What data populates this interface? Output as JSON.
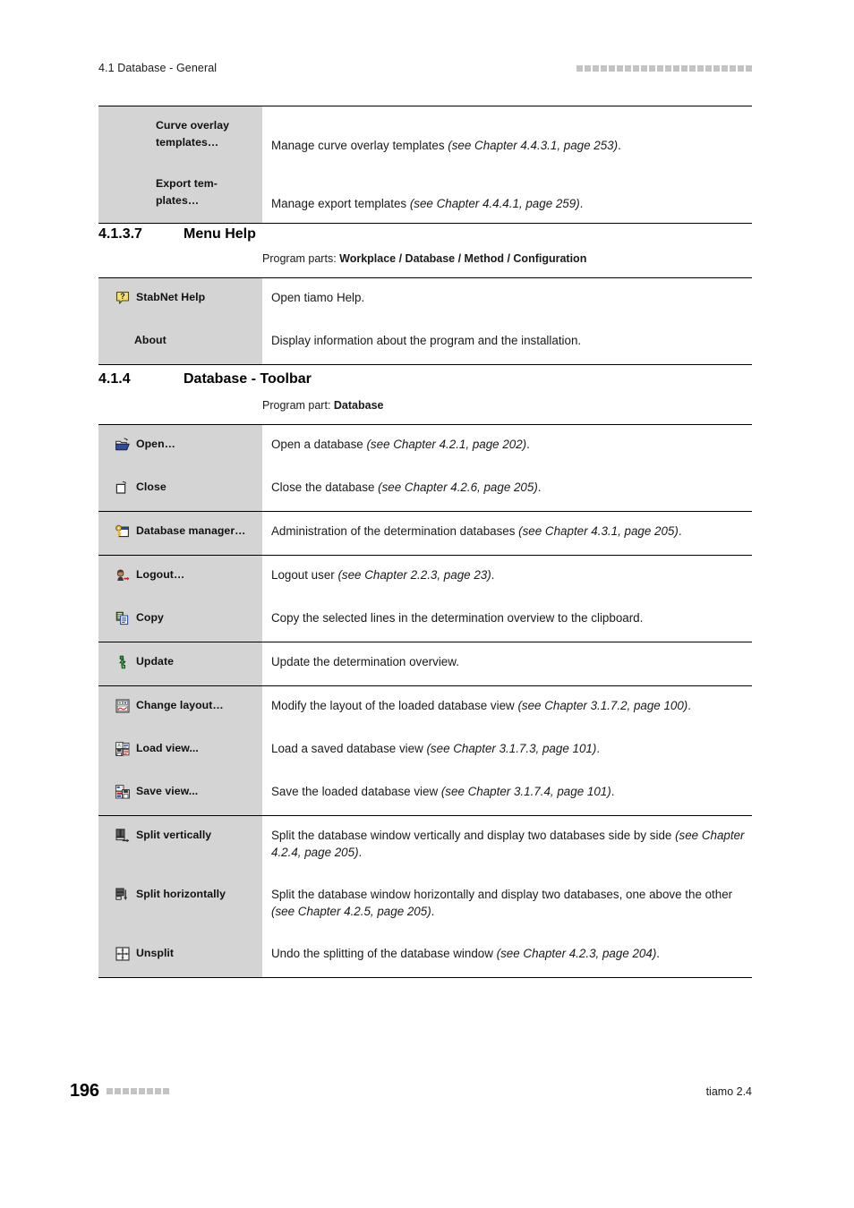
{
  "header": {
    "running_title": "4.1 Database - General",
    "decor_squares": 22
  },
  "footer": {
    "page_number": "196",
    "decor_squares": 8,
    "product": "tiamo 2.4"
  },
  "colors": {
    "label_column_bg": "#d4d4d4",
    "decor_square": "#c3c3c3",
    "rule": "#000000"
  },
  "top_table": {
    "groups": [
      {
        "rows": [
          {
            "icon": "",
            "label": "Curve overlay templates…",
            "desc_plain": "Manage curve overlay templates ",
            "desc_italic": "(see Chapter 4.4.3.1, page 253)",
            "desc_tail": "."
          },
          {
            "icon": "",
            "label": "Export tem-plates…",
            "desc_plain": "Manage export templates ",
            "desc_italic": "(see Chapter 4.4.4.1, page 259)",
            "desc_tail": "."
          }
        ]
      }
    ]
  },
  "section_help": {
    "number": "4.1.3.7",
    "title": "Menu Help",
    "program_parts_prefix": "Program parts: ",
    "program_parts_value": "Workplace / Database / Method / Configuration",
    "groups": [
      {
        "rows": [
          {
            "icon": "help-question-icon",
            "label": "StabNet Help",
            "desc_plain": "Open tiamo Help.",
            "desc_italic": "",
            "desc_tail": ""
          },
          {
            "icon": "",
            "label": "About",
            "desc_plain": "Display information about the program and the installation.",
            "desc_italic": "",
            "desc_tail": ""
          }
        ]
      }
    ]
  },
  "section_toolbar": {
    "number": "4.1.4",
    "title": "Database - Toolbar",
    "program_parts_prefix": "Program part: ",
    "program_parts_value": "Database",
    "groups": [
      {
        "rows": [
          {
            "icon": "open-folder-icon",
            "label": "Open…",
            "desc_plain": "Open a database ",
            "desc_italic": "(see Chapter 4.2.1, page 202)",
            "desc_tail": "."
          },
          {
            "icon": "close-folder-icon",
            "label": "Close",
            "desc_plain": "Close the database ",
            "desc_italic": "(see Chapter 4.2.6, page 205)",
            "desc_tail": "."
          }
        ]
      },
      {
        "rows": [
          {
            "icon": "database-manager-key-icon",
            "label": "Database manager…",
            "desc_plain": "Administration of the determination databases ",
            "desc_italic": "(see Chapter 4.3.1, page 205)",
            "desc_tail": "."
          }
        ]
      },
      {
        "rows": [
          {
            "icon": "logout-user-icon",
            "label": "Logout…",
            "desc_plain": "Logout user ",
            "desc_italic": "(see Chapter 2.2.3, page 23)",
            "desc_tail": "."
          },
          {
            "icon": "copy-icon",
            "label": "Copy",
            "desc_plain": "Copy the selected lines in the determination overview to the clipboard.",
            "desc_italic": "",
            "desc_tail": ""
          }
        ]
      },
      {
        "rows": [
          {
            "icon": "update-refresh-icon",
            "label": "Update",
            "desc_plain": "Update the determination overview.",
            "desc_italic": "",
            "desc_tail": ""
          }
        ]
      },
      {
        "rows": [
          {
            "icon": "change-layout-icon",
            "label": "Change layout…",
            "desc_plain": "Modify the layout of the loaded database view ",
            "desc_italic": "(see Chapter 3.1.7.2, page 100)",
            "desc_tail": "."
          },
          {
            "icon": "load-view-icon",
            "label": "Load view...",
            "desc_plain": "Load a saved database view ",
            "desc_italic": "(see Chapter 3.1.7.3, page 101)",
            "desc_tail": "."
          },
          {
            "icon": "save-view-icon",
            "label": "Save view...",
            "desc_plain": "Save the loaded database view ",
            "desc_italic": "(see Chapter 3.1.7.4, page 101)",
            "desc_tail": "."
          }
        ]
      },
      {
        "rows": [
          {
            "icon": "split-vertically-icon",
            "label": "Split vertically",
            "desc_plain": "Split the database window vertically and display two databases side by side ",
            "desc_italic": "(see Chapter 4.2.4, page 205)",
            "desc_tail": "."
          },
          {
            "icon": "split-horizontally-icon",
            "label": "Split horizontally",
            "desc_plain": "Split the database window horizontally and display two databases, one above the other ",
            "desc_italic": "(see Chapter 4.2.5, page 205)",
            "desc_tail": "."
          },
          {
            "icon": "unsplit-icon",
            "label": "Unsplit",
            "desc_plain": "Undo the splitting of the database window ",
            "desc_italic": "(see Chapter 4.2.3, page 204)",
            "desc_tail": "."
          }
        ]
      }
    ]
  }
}
